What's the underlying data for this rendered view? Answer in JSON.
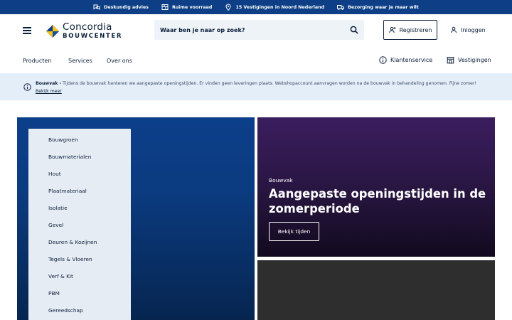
{
  "usp": [
    {
      "label": "Deskundig advies",
      "icon": "advice-icon"
    },
    {
      "label": "Ruime voorraad",
      "icon": "stock-icon"
    },
    {
      "label": "15 Vestigingen in Noord Nederland",
      "icon": "location-pin-icon"
    },
    {
      "label": "Bezorging waar je maar wilt",
      "icon": "truck-icon"
    }
  ],
  "header": {
    "logo_top": "Concordia",
    "logo_bottom": "BOUWCENTER",
    "search_placeholder": "Waar ben je naar op zoek?",
    "register_label": "Registreren",
    "login_label": "Inloggen"
  },
  "nav": {
    "items": [
      "Producten",
      "Services",
      "Over ons"
    ],
    "customer_service": "Klantenservice",
    "locations": "Vestigingen"
  },
  "notice": {
    "title": "Bouwvak -",
    "text": "Tijdens de bouwvak hanteren we aangepaste openingstijden. Er vinden geen leveringen plaats. Webshopaccount aanvragen worden na de bouwvak in behandeling genomen. Fijne zomer!",
    "link": "Bekijk meer"
  },
  "categories": [
    "Bouwgroen",
    "Bouwmaterialen",
    "Hout",
    "Plaatmateriaal",
    "Isolatie",
    "Gevel",
    "Deuren & Kozijnen",
    "Tegels & Vloeren",
    "Verf & Kit",
    "PBM",
    "Gereedschap"
  ],
  "promo": {
    "kicker": "Bouwvak",
    "title": "Aangepaste openingstijden in de zomerperiode",
    "button": "Bekijk tijden"
  },
  "colors": {
    "usp_bar": "#0e3f86",
    "notice_bg": "#e4eef9",
    "text_dark": "#0b1f3a",
    "hero_blue": "#0c3f8a",
    "promo_purple": "#3b1d5e",
    "logo_yellow": "#f4c21b"
  }
}
